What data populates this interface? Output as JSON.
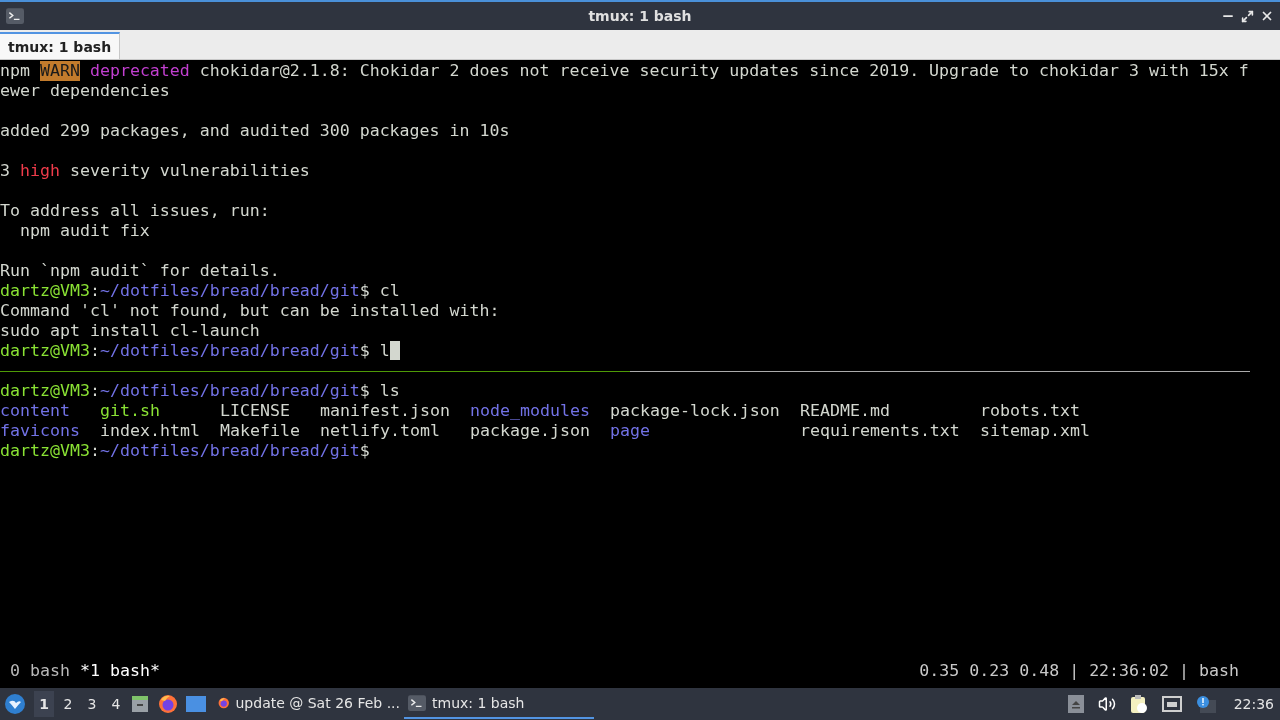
{
  "window": {
    "title": "tmux: 1 bash"
  },
  "tabs": [
    {
      "label": "tmux: 1 bash",
      "selected": true
    }
  ],
  "panes": [
    {
      "active": true,
      "blocks": [
        [
          {
            "kind": "text",
            "cursor": false,
            "segments": [
              {
                "kind": "plain",
                "text": "npm "
              },
              {
                "kind": "warn",
                "text": "WARN"
              },
              {
                "kind": "deprecated",
                "text": " deprecated"
              },
              {
                "kind": "plain",
                "text": " chokidar@2.1.8: Chokidar 2 does not receive security updates since 2019. Upgrade to chokidar 3 with 15x f"
              }
            ]
          },
          {
            "kind": "text",
            "cursor": false,
            "segments": [
              {
                "kind": "plain",
                "text": "ewer dependencies"
              }
            ]
          }
        ],
        [
          {
            "kind": "text",
            "cursor": false,
            "segments": [
              {
                "kind": "plain",
                "text": "added 299 packages, and audited 300 packages in 10s"
              }
            ]
          }
        ],
        [
          {
            "kind": "text",
            "cursor": false,
            "segments": [
              {
                "kind": "plain",
                "text": "3 "
              },
              {
                "kind": "high",
                "text": "high"
              },
              {
                "kind": "plain",
                "text": " severity vulnerabilities"
              }
            ]
          }
        ],
        [
          {
            "kind": "text",
            "cursor": false,
            "segments": [
              {
                "kind": "plain",
                "text": "To address all issues, run:"
              }
            ]
          },
          {
            "kind": "text",
            "cursor": false,
            "segments": [
              {
                "kind": "plain",
                "text": "  npm audit fix"
              }
            ]
          }
        ],
        [
          {
            "kind": "text",
            "cursor": false,
            "segments": [
              {
                "kind": "plain",
                "text": "Run `npm audit` for details."
              }
            ]
          },
          {
            "kind": "text",
            "cursor": false,
            "segments": [
              {
                "kind": "user",
                "text": "dartz@VM3"
              },
              {
                "kind": "plain",
                "text": ":"
              },
              {
                "kind": "path",
                "text": "~/dotfiles/bread/bread/git"
              },
              {
                "kind": "plain",
                "text": "$ cl"
              }
            ]
          },
          {
            "kind": "text",
            "cursor": false,
            "segments": [
              {
                "kind": "plain",
                "text": "Command 'cl' not found, but can be installed with:"
              }
            ]
          },
          {
            "kind": "text",
            "cursor": false,
            "segments": [
              {
                "kind": "plain",
                "text": "sudo apt install cl-launch"
              }
            ]
          },
          {
            "kind": "text",
            "cursor": true,
            "segments": [
              {
                "kind": "user",
                "text": "dartz@VM3"
              },
              {
                "kind": "plain",
                "text": ":"
              },
              {
                "kind": "path",
                "text": "~/dotfiles/bread/bread/git"
              },
              {
                "kind": "plain",
                "text": "$ l"
              }
            ]
          }
        ]
      ]
    },
    {
      "blocks": [
        [
          {
            "kind": "text",
            "cursor": false,
            "segments": [
              {
                "kind": "user",
                "text": "dartz@VM3"
              },
              {
                "kind": "plain",
                "text": ":"
              },
              {
                "kind": "path",
                "text": "~/dotfiles/bread/bread/git"
              },
              {
                "kind": "plain",
                "text": "$ ls"
              }
            ]
          },
          {
            "kind": "listing",
            "rows": [
              [
                {
                  "kind": "dir",
                  "text": "content"
                },
                {
                  "kind": "exec",
                  "text": "git.sh"
                },
                {
                  "kind": "file",
                  "text": "LICENSE"
                },
                {
                  "kind": "file",
                  "text": "manifest.json"
                },
                {
                  "kind": "dir",
                  "text": "node_modules"
                },
                {
                  "kind": "file",
                  "text": "package-lock.json"
                },
                {
                  "kind": "file",
                  "text": "README.md"
                },
                {
                  "kind": "file",
                  "text": "robots.txt"
                }
              ],
              [
                {
                  "kind": "dir",
                  "text": "favicons"
                },
                {
                  "kind": "file",
                  "text": "index.html"
                },
                {
                  "kind": "file",
                  "text": "Makefile"
                },
                {
                  "kind": "file",
                  "text": "netlify.toml"
                },
                {
                  "kind": "file",
                  "text": "package.json"
                },
                {
                  "kind": "dir",
                  "text": "page"
                },
                {
                  "kind": "file",
                  "text": "requirements.txt"
                },
                {
                  "kind": "file",
                  "text": "sitemap.xml"
                }
              ]
            ]
          },
          {
            "kind": "text",
            "cursor": false,
            "segments": [
              {
                "kind": "user",
                "text": "dartz@VM3"
              },
              {
                "kind": "plain",
                "text": ":"
              },
              {
                "kind": "path",
                "text": "~/dotfiles/bread/bread/git"
              },
              {
                "kind": "plain",
                "text": "$"
              }
            ]
          }
        ]
      ]
    }
  ],
  "status_bar": {
    "windows": [
      {
        "label": "0 bash",
        "selected": false
      },
      {
        "label": "*1 bash*",
        "selected": true
      }
    ],
    "right": "0.35 0.23 0.48 | 22:36:02 | bash"
  },
  "taskbar": {
    "workspaces": [
      {
        "label": "1",
        "selected": true
      },
      {
        "label": "2",
        "selected": false
      },
      {
        "label": "3",
        "selected": false
      },
      {
        "label": "4",
        "selected": false
      }
    ],
    "tasks": [
      {
        "kind": "browser",
        "label": "update @ Sat 26 Feb ...",
        "selected": false
      },
      {
        "kind": "terminal",
        "label": "tmux: 1 bash",
        "selected": true
      }
    ],
    "clock": "22:36"
  }
}
